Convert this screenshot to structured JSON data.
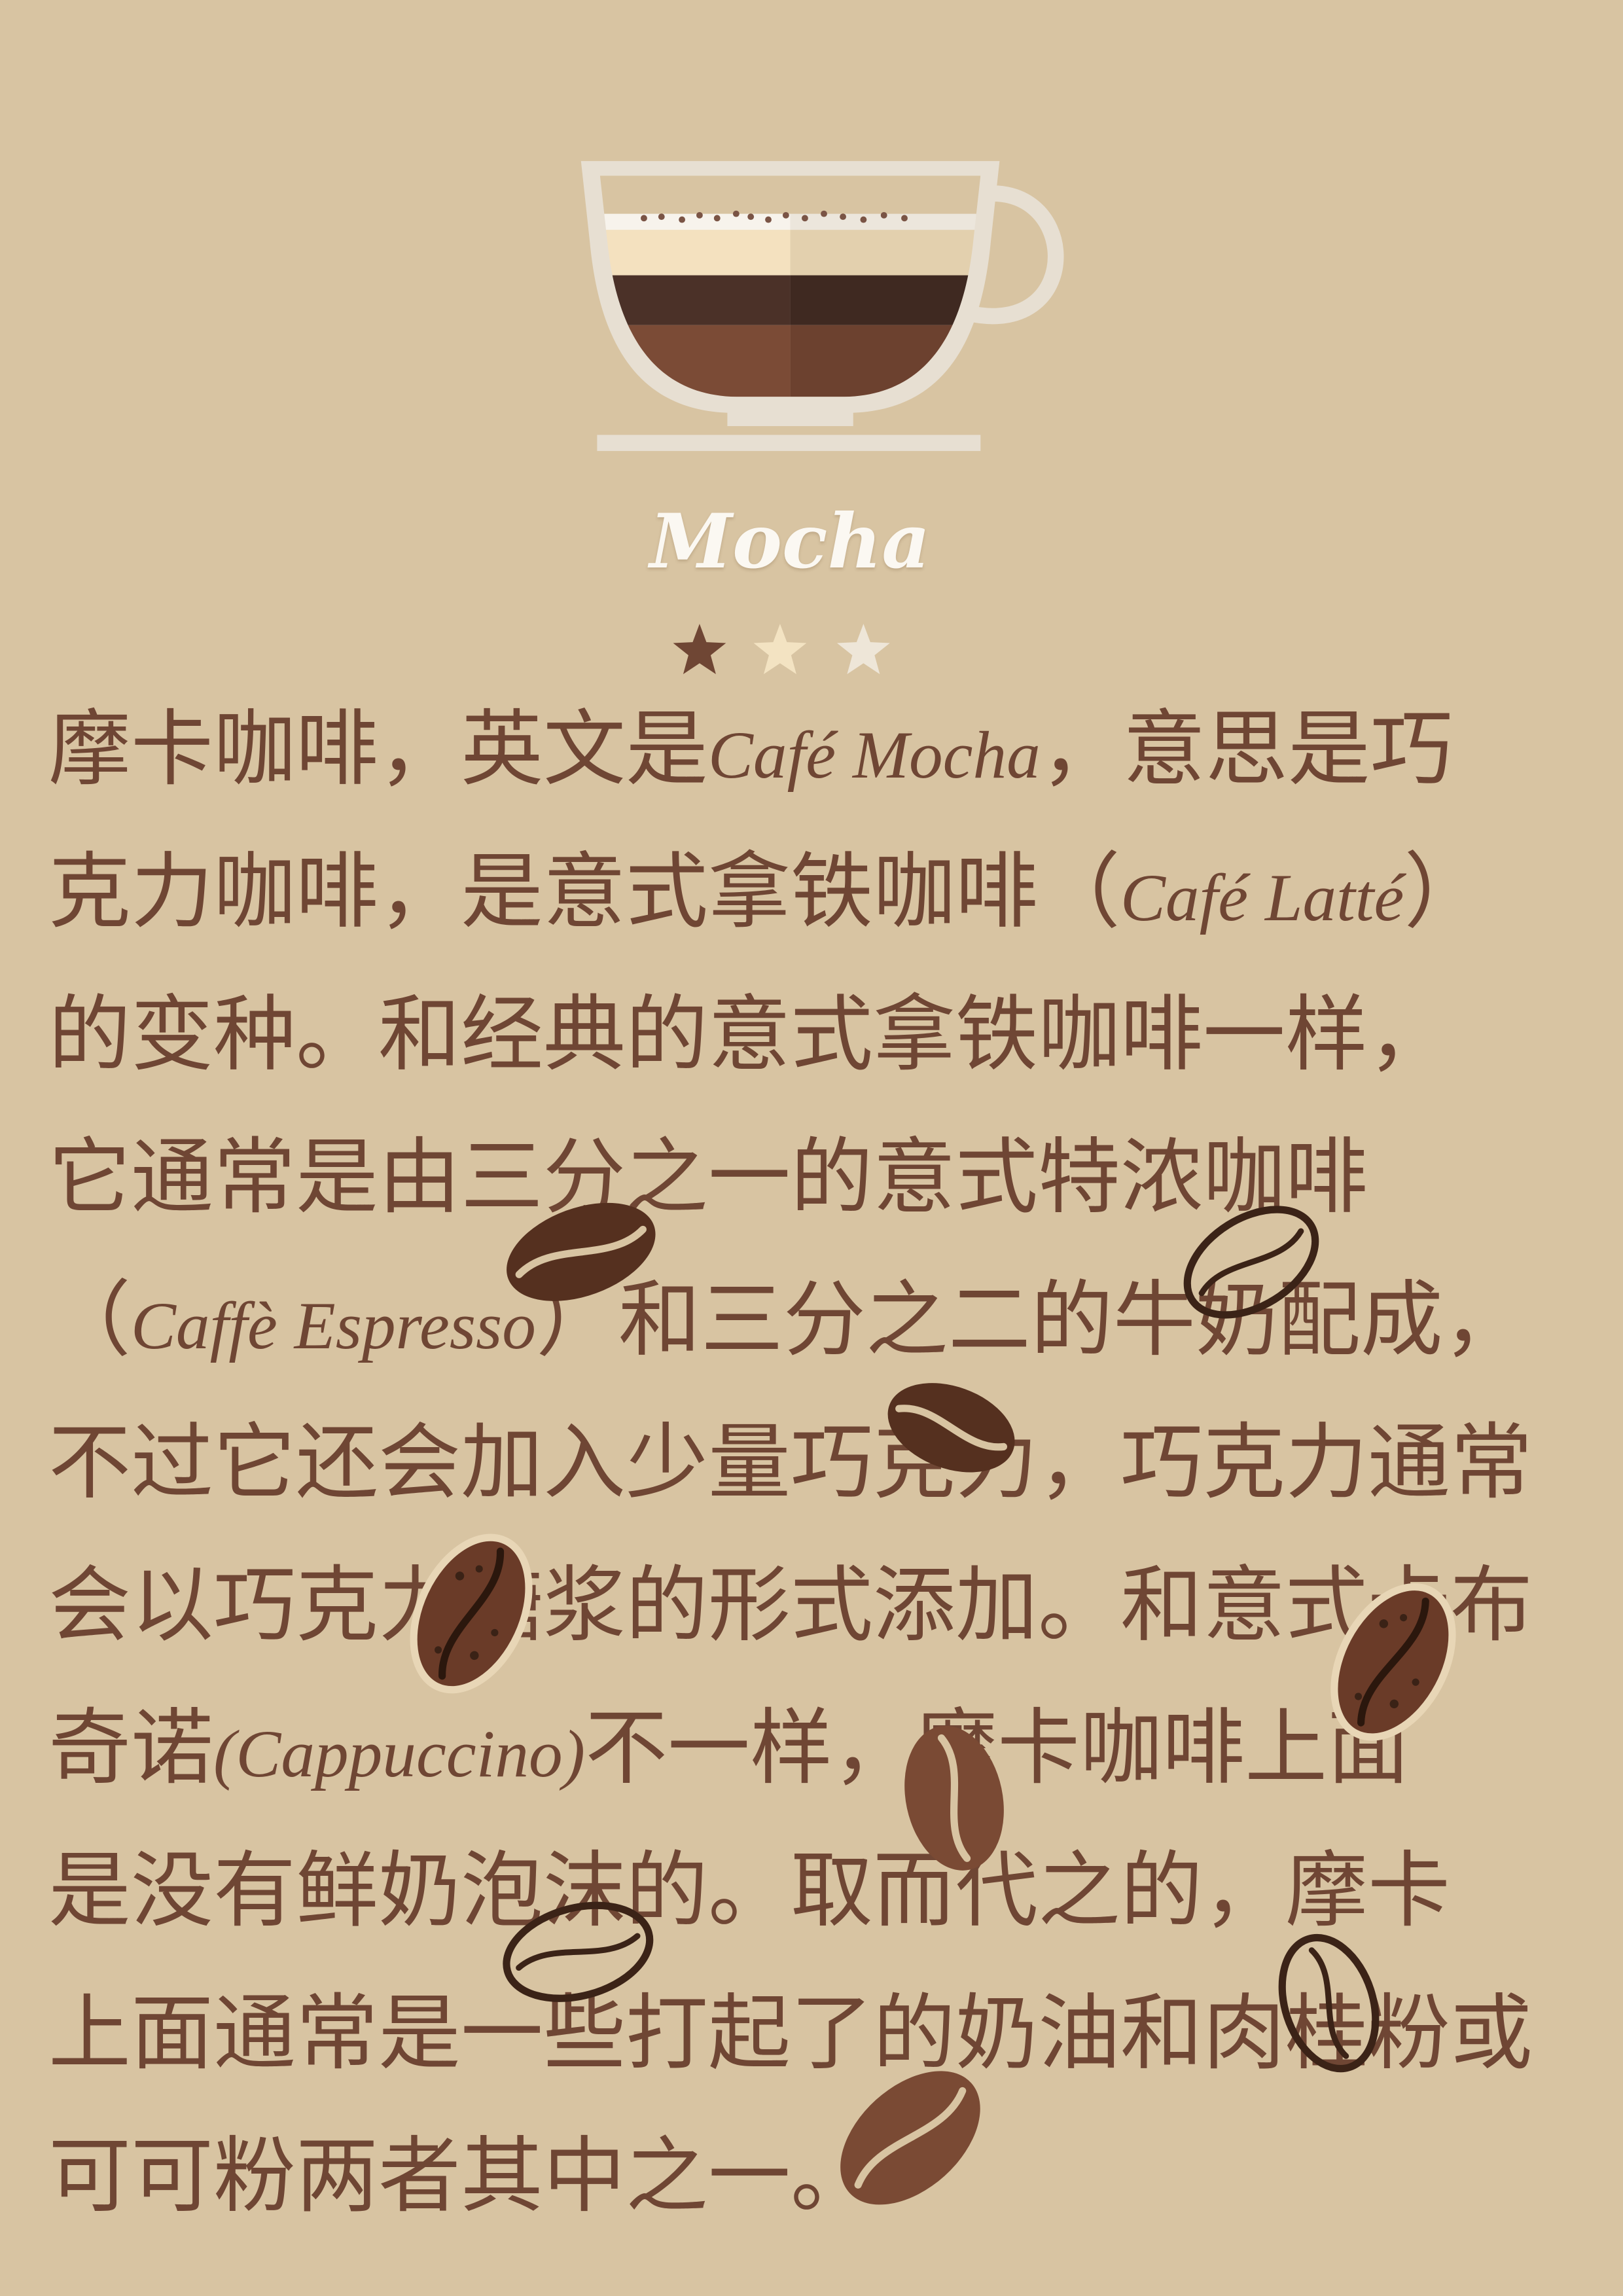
{
  "header": {
    "title": "Mocha"
  },
  "rating": {
    "value": 1,
    "max": 3
  },
  "illustration": {
    "main_icon": "coffee-cup-icon",
    "decoration_icon": "coffee-bean-icon",
    "rating_icon": "star-icon"
  },
  "colors": {
    "background": "#d8c4a2",
    "text": "#6f4634",
    "title": "#fbf8f2",
    "star_filled": "#6f4634",
    "star_empty": [
      "#f3e3c2",
      "#eee6d8"
    ]
  },
  "body": {
    "lines": [
      "摩卡咖啡，英文是Café Mocha，意思是巧",
      "克力咖啡，是意式拿铁咖啡（Café Latté）",
      "的变种。和经典的意式拿铁咖啡一样，",
      "它通常是由三分之一的意式特浓咖啡",
      "（Caffè Espresso）和三分之二的牛奶配成，",
      "不过它还会加入少量巧克力，巧克力通常",
      "会以巧克力糖浆的形式添加。和意式卡布",
      "奇诺(Cappuccino)不一样，摩卡咖啡上面",
      "是没有鲜奶泡沫的。取而代之的，摩卡",
      "上面通常是一些打起了的奶油和肉桂粉或",
      "可可粉两者其中之一。"
    ]
  }
}
